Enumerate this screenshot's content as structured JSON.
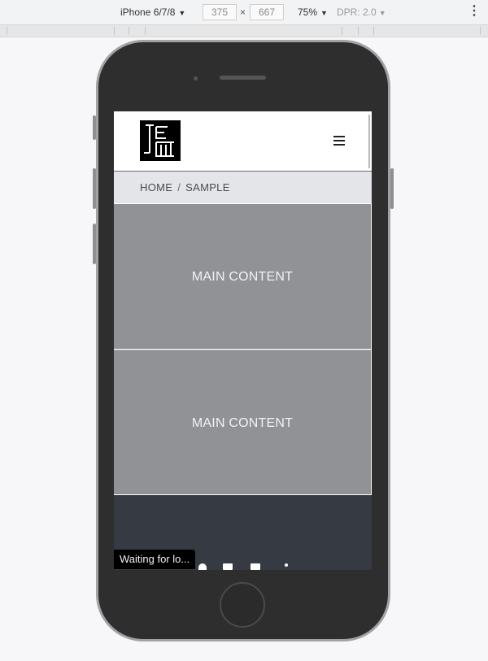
{
  "devtools": {
    "device_name": "iPhone 6/7/8",
    "width_value": "375",
    "height_value": "667",
    "dimension_separator": "×",
    "zoom": "75%",
    "dpr": "DPR: 2.0",
    "more_icon": "more-vert-icon"
  },
  "site": {
    "logo_icon": "brand-logo",
    "menu_icon": "hamburger-menu-icon",
    "breadcrumb": {
      "home": "HOME",
      "separator": "/",
      "current": "SAMPLE"
    },
    "content_blocks": [
      {
        "label": "MAIN CONTENT"
      },
      {
        "label": "MAIN CONTENT"
      }
    ],
    "footer_icons": [
      "social-icon",
      "social-icon",
      "social-icon",
      "social-icon"
    ]
  },
  "status": {
    "text": "Waiting for lo..."
  },
  "colors": {
    "content_bg": "#919296",
    "breadcrumb_bg": "#e4e5e9",
    "footer_bg": "#363a42",
    "phone_body": "#2e2e2f"
  }
}
